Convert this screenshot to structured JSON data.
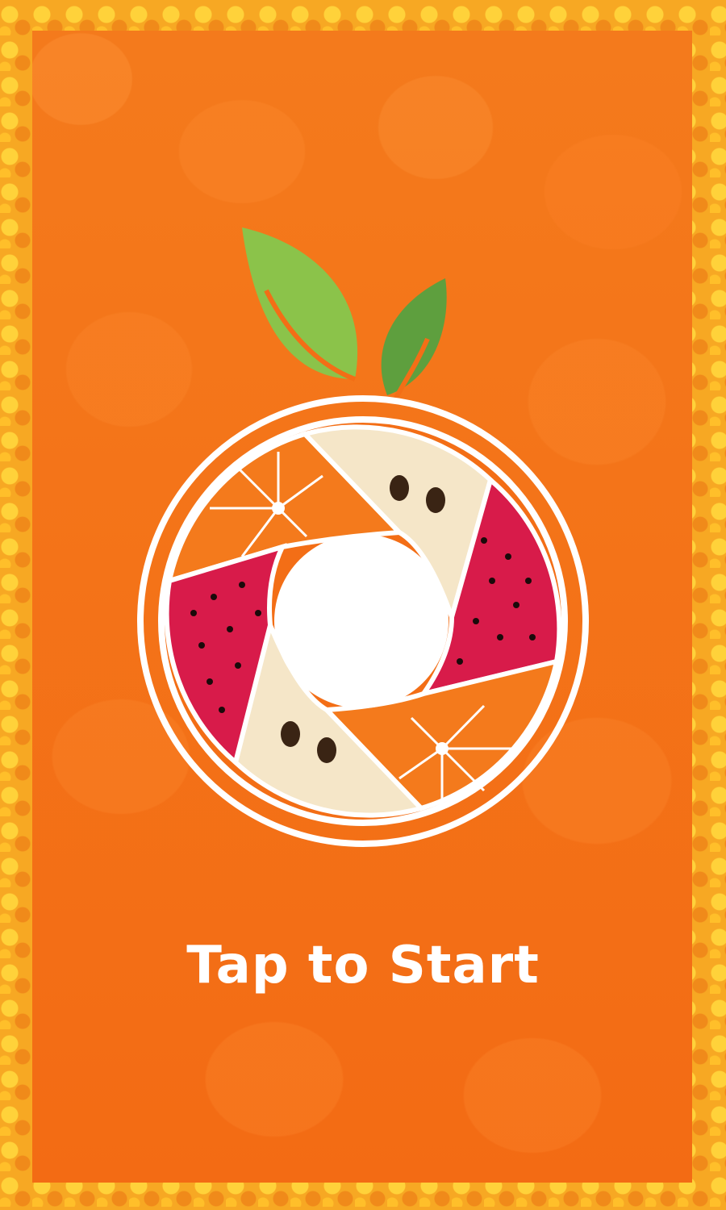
{
  "screen": {
    "start_label": "Tap to Start"
  },
  "logo": {
    "icon": "fruit-shutter-logo-icon",
    "leaf_left_color": "#8bc34a",
    "leaf_right_color": "#5e9f3e",
    "ring_color": "#ffffff",
    "orange_slice_color": "#f47a1c",
    "apple_slice_color": "#f5e6c8",
    "watermelon_color": "#d81b4a"
  },
  "colors": {
    "panel": "#f36e16",
    "border": "#f7a823",
    "text": "#ffffff"
  }
}
